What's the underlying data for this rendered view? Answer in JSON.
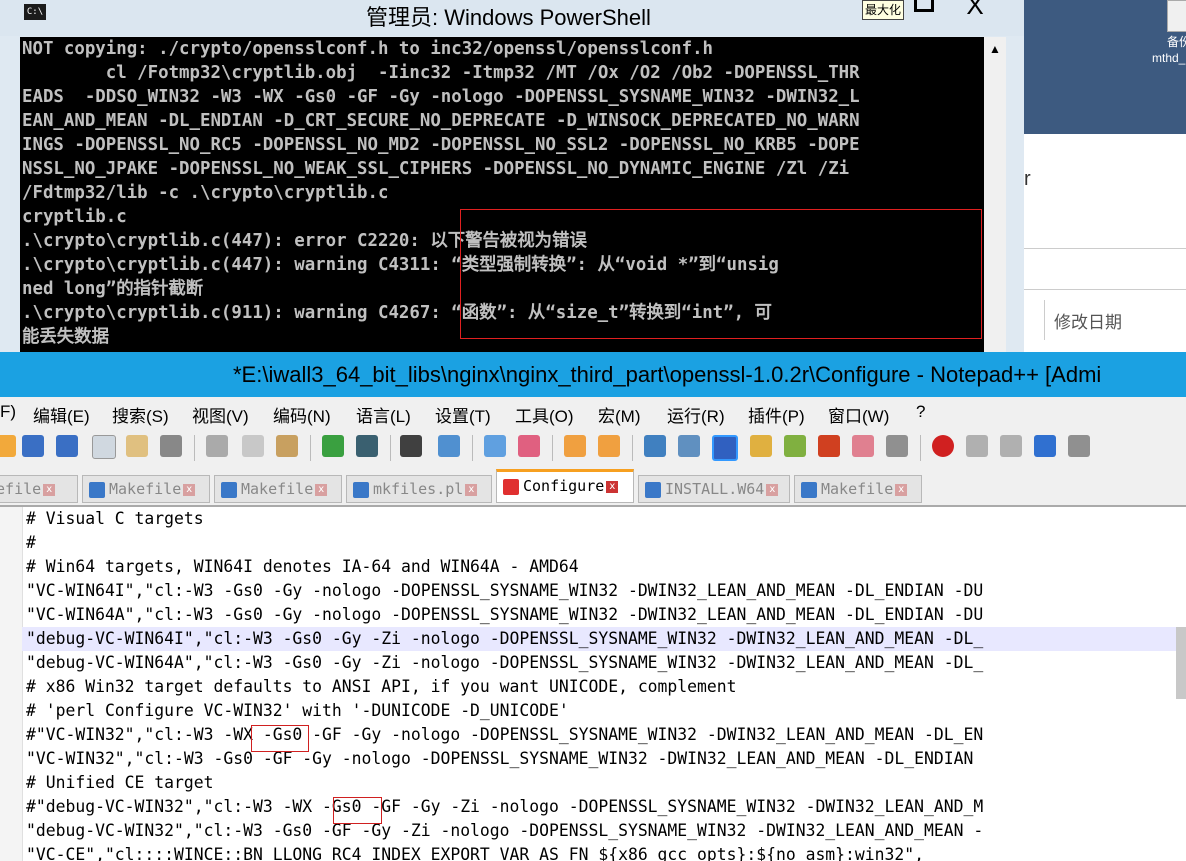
{
  "background_window": {
    "label1": "备份",
    "label2": "mthd_",
    "partial_text": "r",
    "column_header": "修改日期"
  },
  "powershell": {
    "title": "管理员: Windows PowerShell",
    "icon_text": "C:\\",
    "tooltip": "最大化",
    "close_glyph": "X",
    "lines": [
      "NOT copying: ./crypto/opensslconf.h to inc32/openssl/opensslconf.h",
      "        cl /Fotmp32\\cryptlib.obj  -Iinc32 -Itmp32 /MT /Ox /O2 /Ob2 -DOPENSSL_THR",
      "EADS  -DDSO_WIN32 -W3 -WX -Gs0 -GF -Gy -nologo -DOPENSSL_SYSNAME_WIN32 -DWIN32_L",
      "EAN_AND_MEAN -DL_ENDIAN -D_CRT_SECURE_NO_DEPRECATE -D_WINSOCK_DEPRECATED_NO_WARN",
      "INGS -DOPENSSL_NO_RC5 -DOPENSSL_NO_MD2 -DOPENSSL_NO_SSL2 -DOPENSSL_NO_KRB5 -DOPE",
      "NSSL_NO_JPAKE -DOPENSSL_NO_WEAK_SSL_CIPHERS -DOPENSSL_NO_DYNAMIC_ENGINE /Zl /Zi",
      "/Fdtmp32/lib -c .\\crypto\\cryptlib.c",
      "cryptlib.c",
      ".\\crypto\\cryptlib.c(447): error C2220: 以下警告被视为错误",
      ".\\crypto\\cryptlib.c(447): warning C4311: “类型强制转换”: 从“void *”到“unsig",
      "ned long”的指针截断",
      ".\\crypto\\cryptlib.c(911): warning C4267: “函数”: 从“size_t”转换到“int”, 可",
      "能丢失数据"
    ]
  },
  "notepadpp": {
    "title": "*E:\\iwall3_64_bit_libs\\nginx\\nginx_third_part\\openssl-1.0.2r\\Configure - Notepad++ [Admi",
    "menu": [
      "F)",
      "编辑(E)",
      "搜索(S)",
      "视图(V)",
      "编码(N)",
      "语言(L)",
      "设置(T)",
      "工具(O)",
      "宏(M)",
      "运行(R)",
      "插件(P)",
      "窗口(W)",
      "?"
    ],
    "tabs": [
      {
        "label": "kefile",
        "active": false
      },
      {
        "label": "Makefile",
        "active": false
      },
      {
        "label": "Makefile",
        "active": false
      },
      {
        "label": "mkfiles.pl",
        "active": false
      },
      {
        "label": "Configure",
        "active": true
      },
      {
        "label": "INSTALL.W64",
        "active": false
      },
      {
        "label": "Makefile",
        "active": false
      }
    ],
    "code_lines": [
      "# Visual C targets",
      "#",
      "# Win64 targets, WIN64I denotes IA-64 and WIN64A - AMD64",
      "\"VC-WIN64I\",\"cl:-W3 -Gs0 -Gy -nologo -DOPENSSL_SYSNAME_WIN32 -DWIN32_LEAN_AND_MEAN -DL_ENDIAN -DU",
      "\"VC-WIN64A\",\"cl:-W3 -Gs0 -Gy -nologo -DOPENSSL_SYSNAME_WIN32 -DWIN32_LEAN_AND_MEAN -DL_ENDIAN -DU",
      "\"debug-VC-WIN64I\",\"cl:-W3 -Gs0 -Gy -Zi -nologo -DOPENSSL_SYSNAME_WIN32 -DWIN32_LEAN_AND_MEAN -DL_",
      "\"debug-VC-WIN64A\",\"cl:-W3 -Gs0 -Gy -Zi -nologo -DOPENSSL_SYSNAME_WIN32 -DWIN32_LEAN_AND_MEAN -DL_",
      "# x86 Win32 target defaults to ANSI API, if you want UNICODE, complement",
      "# 'perl Configure VC-WIN32' with '-DUNICODE -D_UNICODE'",
      "#\"VC-WIN32\",\"cl:-W3 -WX -Gs0 -GF -Gy -nologo -DOPENSSL_SYSNAME_WIN32 -DWIN32_LEAN_AND_MEAN -DL_EN",
      "\"VC-WIN32\",\"cl:-W3 -Gs0 -GF -Gy -nologo -DOPENSSL_SYSNAME_WIN32 -DWIN32_LEAN_AND_MEAN -DL_ENDIAN",
      "# Unified CE target",
      "#\"debug-VC-WIN32\",\"cl:-W3 -WX -Gs0 -GF -Gy -Zi -nologo -DOPENSSL_SYSNAME_WIN32 -DWIN32_LEAN_AND_M",
      "\"debug-VC-WIN32\",\"cl:-W3 -Gs0 -GF -Gy -Zi -nologo -DOPENSSL_SYSNAME_WIN32 -DWIN32_LEAN_AND_MEAN -",
      "\"VC-CE\",\"cl::::WINCE::BN_LLONG RC4_INDEX EXPORT_VAR_AS_FN ${x86_gcc_opts}:${no_asm}:win32\","
    ]
  },
  "colors": {
    "console_bg": "#000000",
    "console_fg": "#c0c0c0",
    "npp_titlebar": "#1ba1e2",
    "highlight_box": "#d02020"
  }
}
